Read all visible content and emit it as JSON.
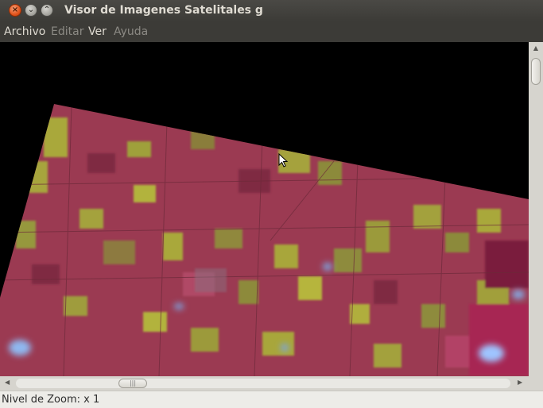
{
  "window": {
    "title": "Visor de Imagenes Satelitales g",
    "close_glyph": "×",
    "minimize_glyph": "⌄",
    "maximize_glyph": "⌃"
  },
  "menu": {
    "items": [
      {
        "label": "Archivo",
        "enabled": true
      },
      {
        "label": "Editar",
        "enabled": false
      },
      {
        "label": "Ver",
        "enabled": true
      },
      {
        "label": "Ayuda",
        "enabled": false
      }
    ]
  },
  "scrollbars": {
    "up_arrow": "▲",
    "left_arrow": "◀",
    "right_arrow": "▶",
    "horizontal_grip": "|||"
  },
  "status": {
    "zoom_text": "Nivel de Zoom: x 1"
  },
  "colors": {
    "canvas_background": "#000000",
    "field_magenta": "#9b3a52",
    "field_olive": "#a9a83a",
    "field_dark": "#7f2c43",
    "cloud": "#8fb8f0"
  },
  "icons": {
    "close": "close-icon",
    "minimize": "minimize-icon",
    "maximize": "maximize-icon",
    "cursor": "mouse-pointer-icon"
  }
}
